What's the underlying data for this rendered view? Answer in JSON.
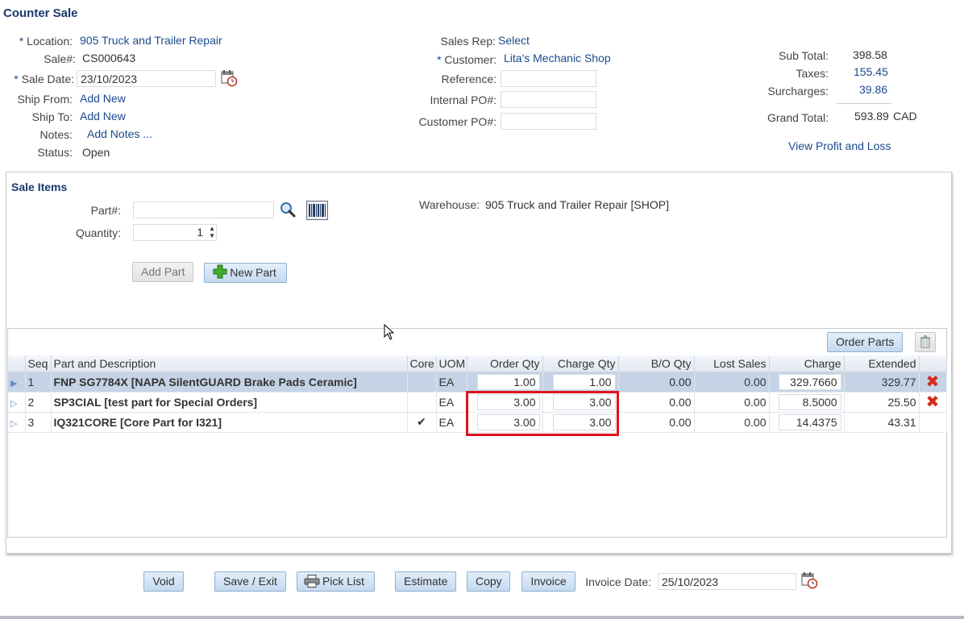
{
  "page_title": "Counter Sale",
  "header": {
    "location_label": "Location:",
    "location_value": "905 Truck and Trailer Repair",
    "sale_no_label": "Sale#:",
    "sale_no_value": "CS000643",
    "sale_date_label": "Sale Date:",
    "sale_date_value": "23/10/2023",
    "ship_from_label": "Ship From:",
    "ship_from_link": "Add New",
    "ship_to_label": "Ship To:",
    "ship_to_link": "Add New",
    "notes_label": "Notes:",
    "notes_link": "Add Notes ...",
    "status_label": "Status:",
    "status_value": "Open",
    "sales_rep_label": "Sales Rep:",
    "sales_rep_link": "Select",
    "customer_label": "Customer:",
    "customer_link": "Lita's Mechanic Shop",
    "reference_label": "Reference:",
    "internal_po_label": "Internal PO#:",
    "customer_po_label": "Customer PO#:",
    "required_mark": "*"
  },
  "totals": {
    "subtotal_label": "Sub Total:",
    "subtotal_value": "398.58",
    "taxes_label": "Taxes:",
    "taxes_value": "155.45",
    "surcharges_label": "Surcharges:",
    "surcharges_value": "39.86",
    "grand_total_label": "Grand Total:",
    "grand_total_value": "593.89",
    "currency": "CAD",
    "profit_loss_link": "View Profit and Loss"
  },
  "sale_items": {
    "title": "Sale Items",
    "part_label": "Part#:",
    "part_value": "",
    "quantity_label": "Quantity:",
    "quantity_value": "1",
    "warehouse_label": "Warehouse:",
    "warehouse_value": "905 Truck and Trailer Repair [SHOP]",
    "add_part_label": "Add Part",
    "new_part_label": "New Part",
    "order_parts_label": "Order Parts"
  },
  "grid": {
    "columns": [
      "Seq",
      "Part and Description",
      "Core",
      "UOM",
      "Order Qty",
      "Charge Qty",
      "B/O Qty",
      "Lost Sales",
      "Charge",
      "Extended"
    ],
    "rows": [
      {
        "seq": "1",
        "desc": "FNP SG7784X [NAPA SilentGUARD Brake Pads Ceramic]",
        "core": "",
        "uom": "EA",
        "order_qty": "1.00",
        "charge_qty": "1.00",
        "bo_qty": "0.00",
        "lost_sales": "0.00",
        "charge": "329.7660",
        "extended": "329.77",
        "deletable": true,
        "selected": true
      },
      {
        "seq": "2",
        "desc": "SP3CIAL [test part for Special Orders]",
        "core": "",
        "uom": "EA",
        "order_qty": "3.00",
        "charge_qty": "3.00",
        "bo_qty": "0.00",
        "lost_sales": "0.00",
        "charge": "8.5000",
        "extended": "25.50",
        "deletable": true,
        "selected": false
      },
      {
        "seq": "3",
        "desc": "IQ321CORE [Core Part for I321]",
        "core": "✔",
        "uom": "EA",
        "order_qty": "3.00",
        "charge_qty": "3.00",
        "bo_qty": "0.00",
        "lost_sales": "0.00",
        "charge": "14.4375",
        "extended": "43.31",
        "deletable": false,
        "selected": false
      }
    ]
  },
  "footer": {
    "void_label": "Void",
    "save_exit_label": "Save / Exit",
    "pick_list_label": "Pick List",
    "estimate_label": "Estimate",
    "copy_label": "Copy",
    "invoice_label": "Invoice",
    "invoice_date_label": "Invoice Date:",
    "invoice_date_value": "25/10/2023"
  },
  "colors": {
    "link": "#1a4a8e",
    "highlight_box": "#e0141b",
    "selected_row": "#c5d3e6",
    "delete_icon": "#d42b1b"
  }
}
